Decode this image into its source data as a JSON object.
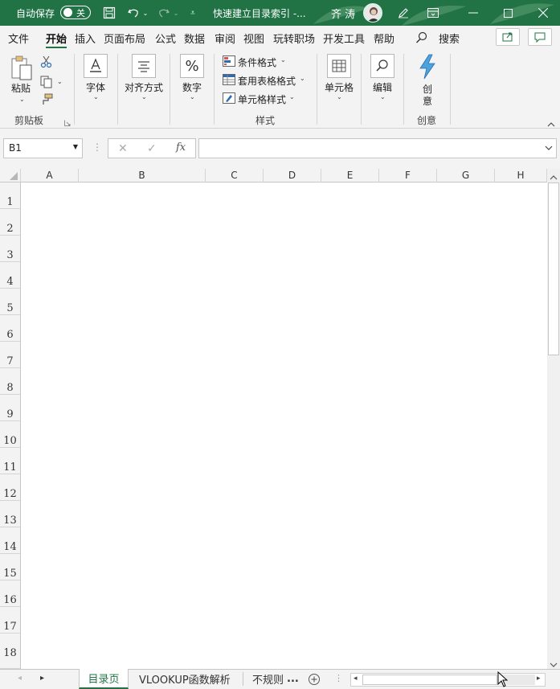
{
  "titlebar": {
    "autosave_label": "自动保存",
    "autosave_state": "关",
    "doc_title": "快速建立目录索引 -...",
    "user_name": "齐 涛"
  },
  "menu": {
    "tabs": [
      "文件",
      "开始",
      "插入",
      "页面布局",
      "公式",
      "数据",
      "审阅",
      "视图",
      "玩转职场",
      "开发工具",
      "帮助"
    ],
    "active_tab": "开始",
    "search_label": "搜索"
  },
  "ribbon": {
    "clipboard": {
      "paste_label": "粘贴",
      "group_label": "剪贴板"
    },
    "font": {
      "label": "字体"
    },
    "alignment": {
      "label": "对齐方式"
    },
    "number": {
      "label": "数字"
    },
    "styles": {
      "conditional_format": "条件格式",
      "format_as_table": "套用表格格式",
      "cell_styles": "单元格样式",
      "group_label": "样式"
    },
    "cells": {
      "label": "单元格"
    },
    "editing": {
      "label": "编辑"
    },
    "creative": {
      "button_label": "创\n意",
      "btn_line1": "创",
      "btn_line2": "意",
      "group_label": "创意"
    }
  },
  "formula_bar": {
    "name_box": "B1",
    "fx_label": "fx",
    "formula_value": ""
  },
  "grid": {
    "columns": [
      "A",
      "B",
      "C",
      "D",
      "E",
      "F",
      "G",
      "H"
    ],
    "rows": [
      "1",
      "2",
      "3",
      "4",
      "5",
      "6",
      "7",
      "8",
      "9",
      "10",
      "11",
      "12",
      "13",
      "14",
      "15",
      "16",
      "17",
      "18"
    ]
  },
  "sheets": {
    "tabs": [
      "目录页",
      "VLOOKUP函数解析",
      "不规则"
    ],
    "active": "目录页",
    "overflow": "..."
  },
  "colors": {
    "accent": "#217346",
    "ribbon_bg": "#f3f3f3"
  }
}
